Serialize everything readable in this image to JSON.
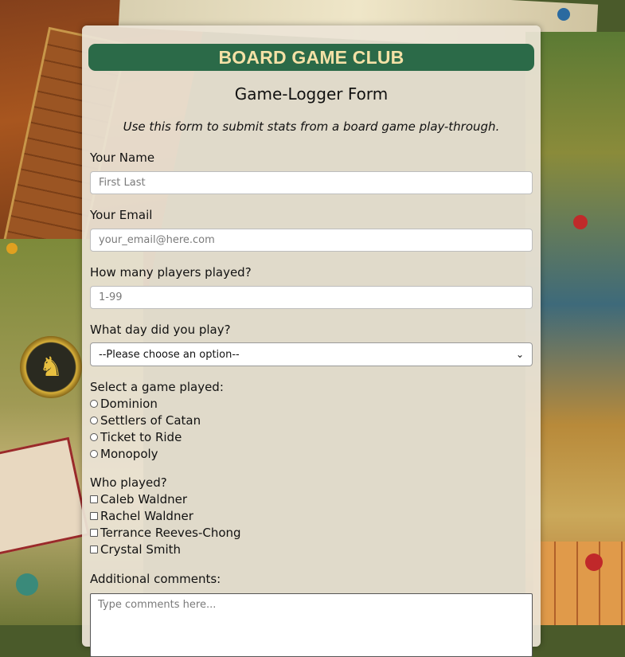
{
  "header": {
    "club_name": "BOARD GAME CLUB"
  },
  "form": {
    "title": "Game-Logger Form",
    "intro": "Use this form to submit stats from a board game play-through.",
    "name": {
      "label": "Your Name",
      "placeholder": "First Last"
    },
    "email": {
      "label": "Your Email",
      "placeholder": "your_email@here.com"
    },
    "players": {
      "label": "How many players played?",
      "placeholder": "1-99"
    },
    "day": {
      "label": "What day did you play?",
      "selected": "--Please choose an option--"
    },
    "game": {
      "label": "Select a game played:",
      "options": [
        "Dominion",
        "Settlers of Catan",
        "Ticket to Ride",
        "Monopoly"
      ]
    },
    "who": {
      "label": "Who played?",
      "options": [
        "Caleb Waldner",
        "Rachel Waldner",
        "Terrance Reeves-Chong",
        "Crystal Smith"
      ]
    },
    "comments": {
      "label": "Additional comments:",
      "placeholder": "Type comments here..."
    }
  },
  "colors": {
    "banner": "#2b6a48",
    "banner_text": "#f4e1a6",
    "panel": "#ece4d6"
  },
  "icons": {
    "select_arrow": "chevron-down-icon"
  }
}
